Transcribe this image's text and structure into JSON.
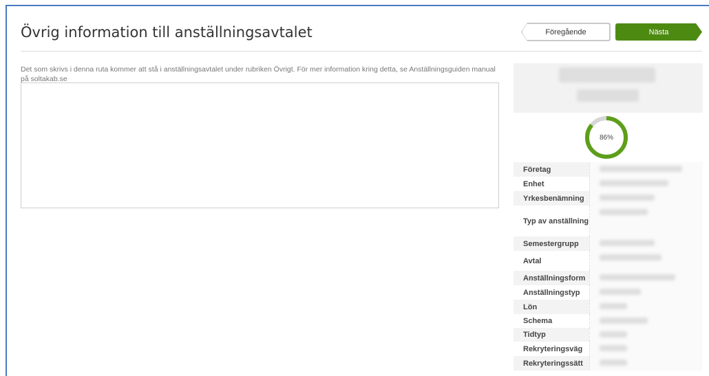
{
  "page": {
    "title": "Övrig information till anställningsavtalet"
  },
  "nav": {
    "prev_label": "Föregående",
    "next_label": "Nästa",
    "next_color": "#4d8a12"
  },
  "notes": {
    "help_text": "Det som skrivs i denna ruta kommer att stå i anställningsavtalet under rubriken Övrigt. För mer information kring detta, se Anställningsguiden manual på soltakab.se",
    "value": ""
  },
  "summary": {
    "progress_label": "86%",
    "progress_value": 86,
    "progress_color": "#5e9e1a",
    "progress_track_color": "#d6d6d6",
    "fields": [
      {
        "label": "Företag"
      },
      {
        "label": "Enhet"
      },
      {
        "label": "Yrkesbenämning"
      },
      {
        "label": "Typ av anställning"
      },
      {
        "label": "Semestergrupp"
      },
      {
        "label": "Avtal"
      },
      {
        "label": "Anställningsform"
      },
      {
        "label": "Anställningstyp"
      },
      {
        "label": "Lön"
      },
      {
        "label": "Schema"
      },
      {
        "label": "Tidtyp"
      },
      {
        "label": "Rekryteringsväg"
      },
      {
        "label": "Rekryteringssätt"
      }
    ]
  }
}
